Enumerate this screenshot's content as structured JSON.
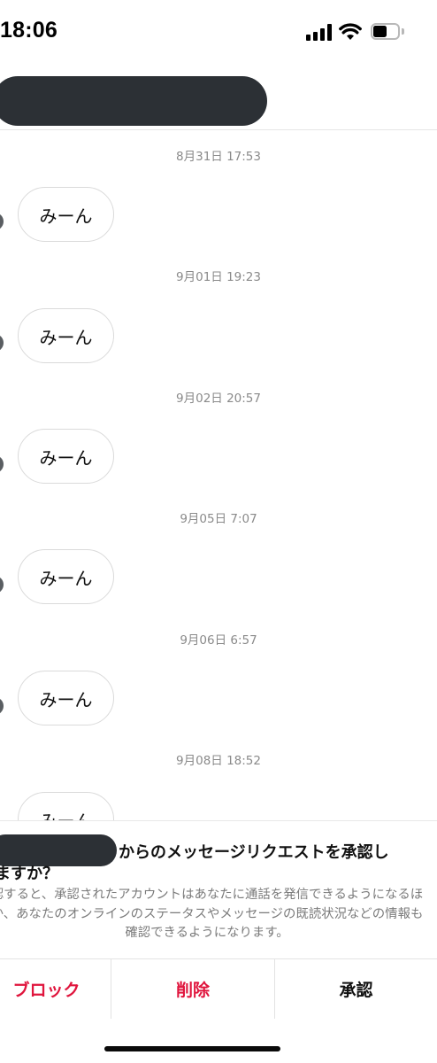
{
  "status_bar": {
    "time": "18:06"
  },
  "conversation": [
    {
      "timestamp": "8月31日 17:53",
      "message": "みーん"
    },
    {
      "timestamp": "9月01日 19:23",
      "message": "みーん"
    },
    {
      "timestamp": "9月02日 20:57",
      "message": "みーん"
    },
    {
      "timestamp": "9月05日 7:07",
      "message": "みーん"
    },
    {
      "timestamp": "9月06日 6:57",
      "message": "みーん"
    },
    {
      "timestamp": "9月08日 18:52",
      "message": "みーん"
    }
  ],
  "request_panel": {
    "title_line1": "からのメッセージリクエストを承認し",
    "title_line2": "ますか？",
    "body": "認すると、承認されたアカウントはあなたに通話を発信できるようになるほか、あなたのオンラインのステータスやメッセージの既読状況などの情報も確認できるようになります。",
    "actions": {
      "block": "ブロック",
      "delete": "削除",
      "accept": "承認"
    }
  },
  "colors": {
    "danger": "#e0153d",
    "redaction": "#2c3035",
    "timestamp": "#8a8a8a"
  },
  "icons": [
    "signal-icon",
    "wifi-icon",
    "battery-icon"
  ]
}
